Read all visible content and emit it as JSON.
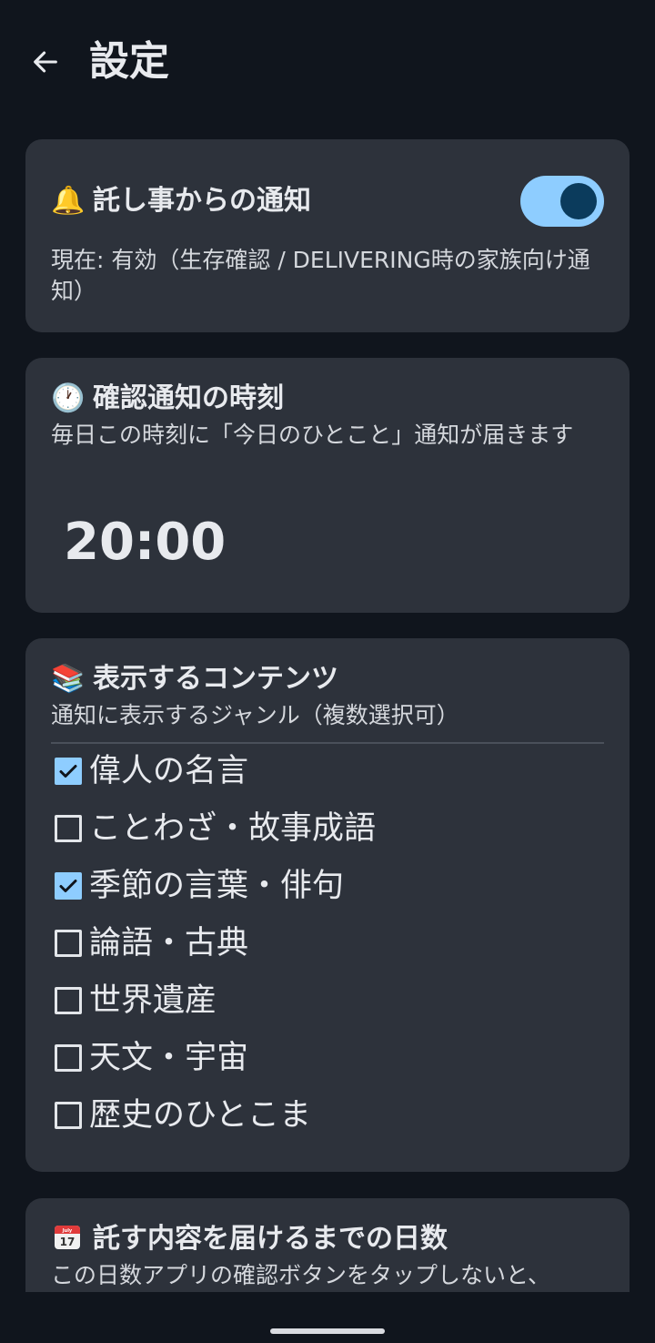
{
  "header": {
    "title": "設定"
  },
  "notification_card": {
    "emoji": "🔔",
    "title": "託し事からの通知",
    "status": "現在: 有効（生存確認 / DELIVERING時の家族向け通知）",
    "toggle_on": true
  },
  "time_card": {
    "emoji": "🕐",
    "title": "確認通知の時刻",
    "description": "毎日この時刻に「今日のひとこと」通知が届きます",
    "time": "20:00"
  },
  "content_card": {
    "emoji": "📚",
    "title": "表示するコンテンツ",
    "description": "通知に表示するジャンル（複数選択可）",
    "options": [
      {
        "label": "偉人の名言",
        "checked": true
      },
      {
        "label": "ことわざ・故事成語",
        "checked": false
      },
      {
        "label": "季節の言葉・俳句",
        "checked": true
      },
      {
        "label": "論語・古典",
        "checked": false
      },
      {
        "label": "世界遺産",
        "checked": false
      },
      {
        "label": "天文・宇宙",
        "checked": false
      },
      {
        "label": "歴史のひとこま",
        "checked": false
      }
    ]
  },
  "days_card": {
    "emoji_icon": "calendar-icon",
    "calendar_text": "July",
    "calendar_day": "17",
    "title": "託す内容を届けるまでの日数",
    "description": "この日数アプリの確認ボタンをタップしないと、"
  },
  "colors": {
    "background": "#10151d",
    "card": "#2d323b",
    "accent": "#8ecdff"
  }
}
